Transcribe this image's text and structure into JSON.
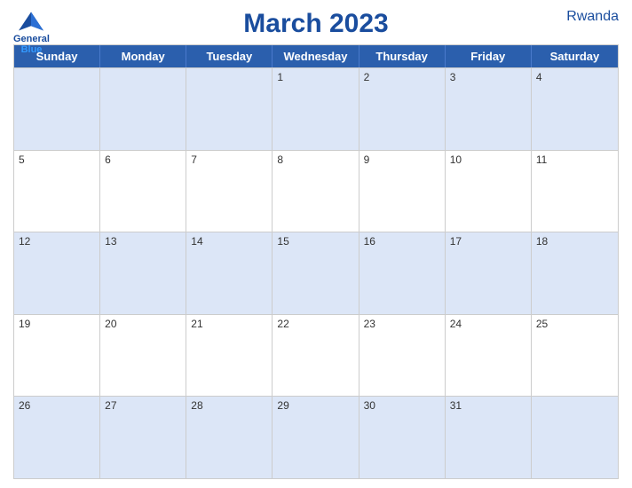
{
  "header": {
    "title": "March 2023",
    "country": "Rwanda",
    "logo": {
      "line1": "General",
      "line2": "Blue"
    }
  },
  "days_of_week": [
    "Sunday",
    "Monday",
    "Tuesday",
    "Wednesday",
    "Thursday",
    "Friday",
    "Saturday"
  ],
  "weeks": [
    [
      {
        "num": "",
        "empty": true
      },
      {
        "num": "",
        "empty": true
      },
      {
        "num": "",
        "empty": true
      },
      {
        "num": "1",
        "empty": false
      },
      {
        "num": "2",
        "empty": false
      },
      {
        "num": "3",
        "empty": false
      },
      {
        "num": "4",
        "empty": false
      }
    ],
    [
      {
        "num": "5",
        "empty": false
      },
      {
        "num": "6",
        "empty": false
      },
      {
        "num": "7",
        "empty": false
      },
      {
        "num": "8",
        "empty": false
      },
      {
        "num": "9",
        "empty": false
      },
      {
        "num": "10",
        "empty": false
      },
      {
        "num": "11",
        "empty": false
      }
    ],
    [
      {
        "num": "12",
        "empty": false
      },
      {
        "num": "13",
        "empty": false
      },
      {
        "num": "14",
        "empty": false
      },
      {
        "num": "15",
        "empty": false
      },
      {
        "num": "16",
        "empty": false
      },
      {
        "num": "17",
        "empty": false
      },
      {
        "num": "18",
        "empty": false
      }
    ],
    [
      {
        "num": "19",
        "empty": false
      },
      {
        "num": "20",
        "empty": false
      },
      {
        "num": "21",
        "empty": false
      },
      {
        "num": "22",
        "empty": false
      },
      {
        "num": "23",
        "empty": false
      },
      {
        "num": "24",
        "empty": false
      },
      {
        "num": "25",
        "empty": false
      }
    ],
    [
      {
        "num": "26",
        "empty": false
      },
      {
        "num": "27",
        "empty": false
      },
      {
        "num": "28",
        "empty": false
      },
      {
        "num": "29",
        "empty": false
      },
      {
        "num": "30",
        "empty": false
      },
      {
        "num": "31",
        "empty": false
      },
      {
        "num": "",
        "empty": true
      }
    ]
  ],
  "colors": {
    "header_bg": "#2b5fad",
    "odd_row_bg": "#dce6f7",
    "even_row_bg": "#ffffff",
    "title_color": "#1a4d9e",
    "text_color": "#333333"
  }
}
